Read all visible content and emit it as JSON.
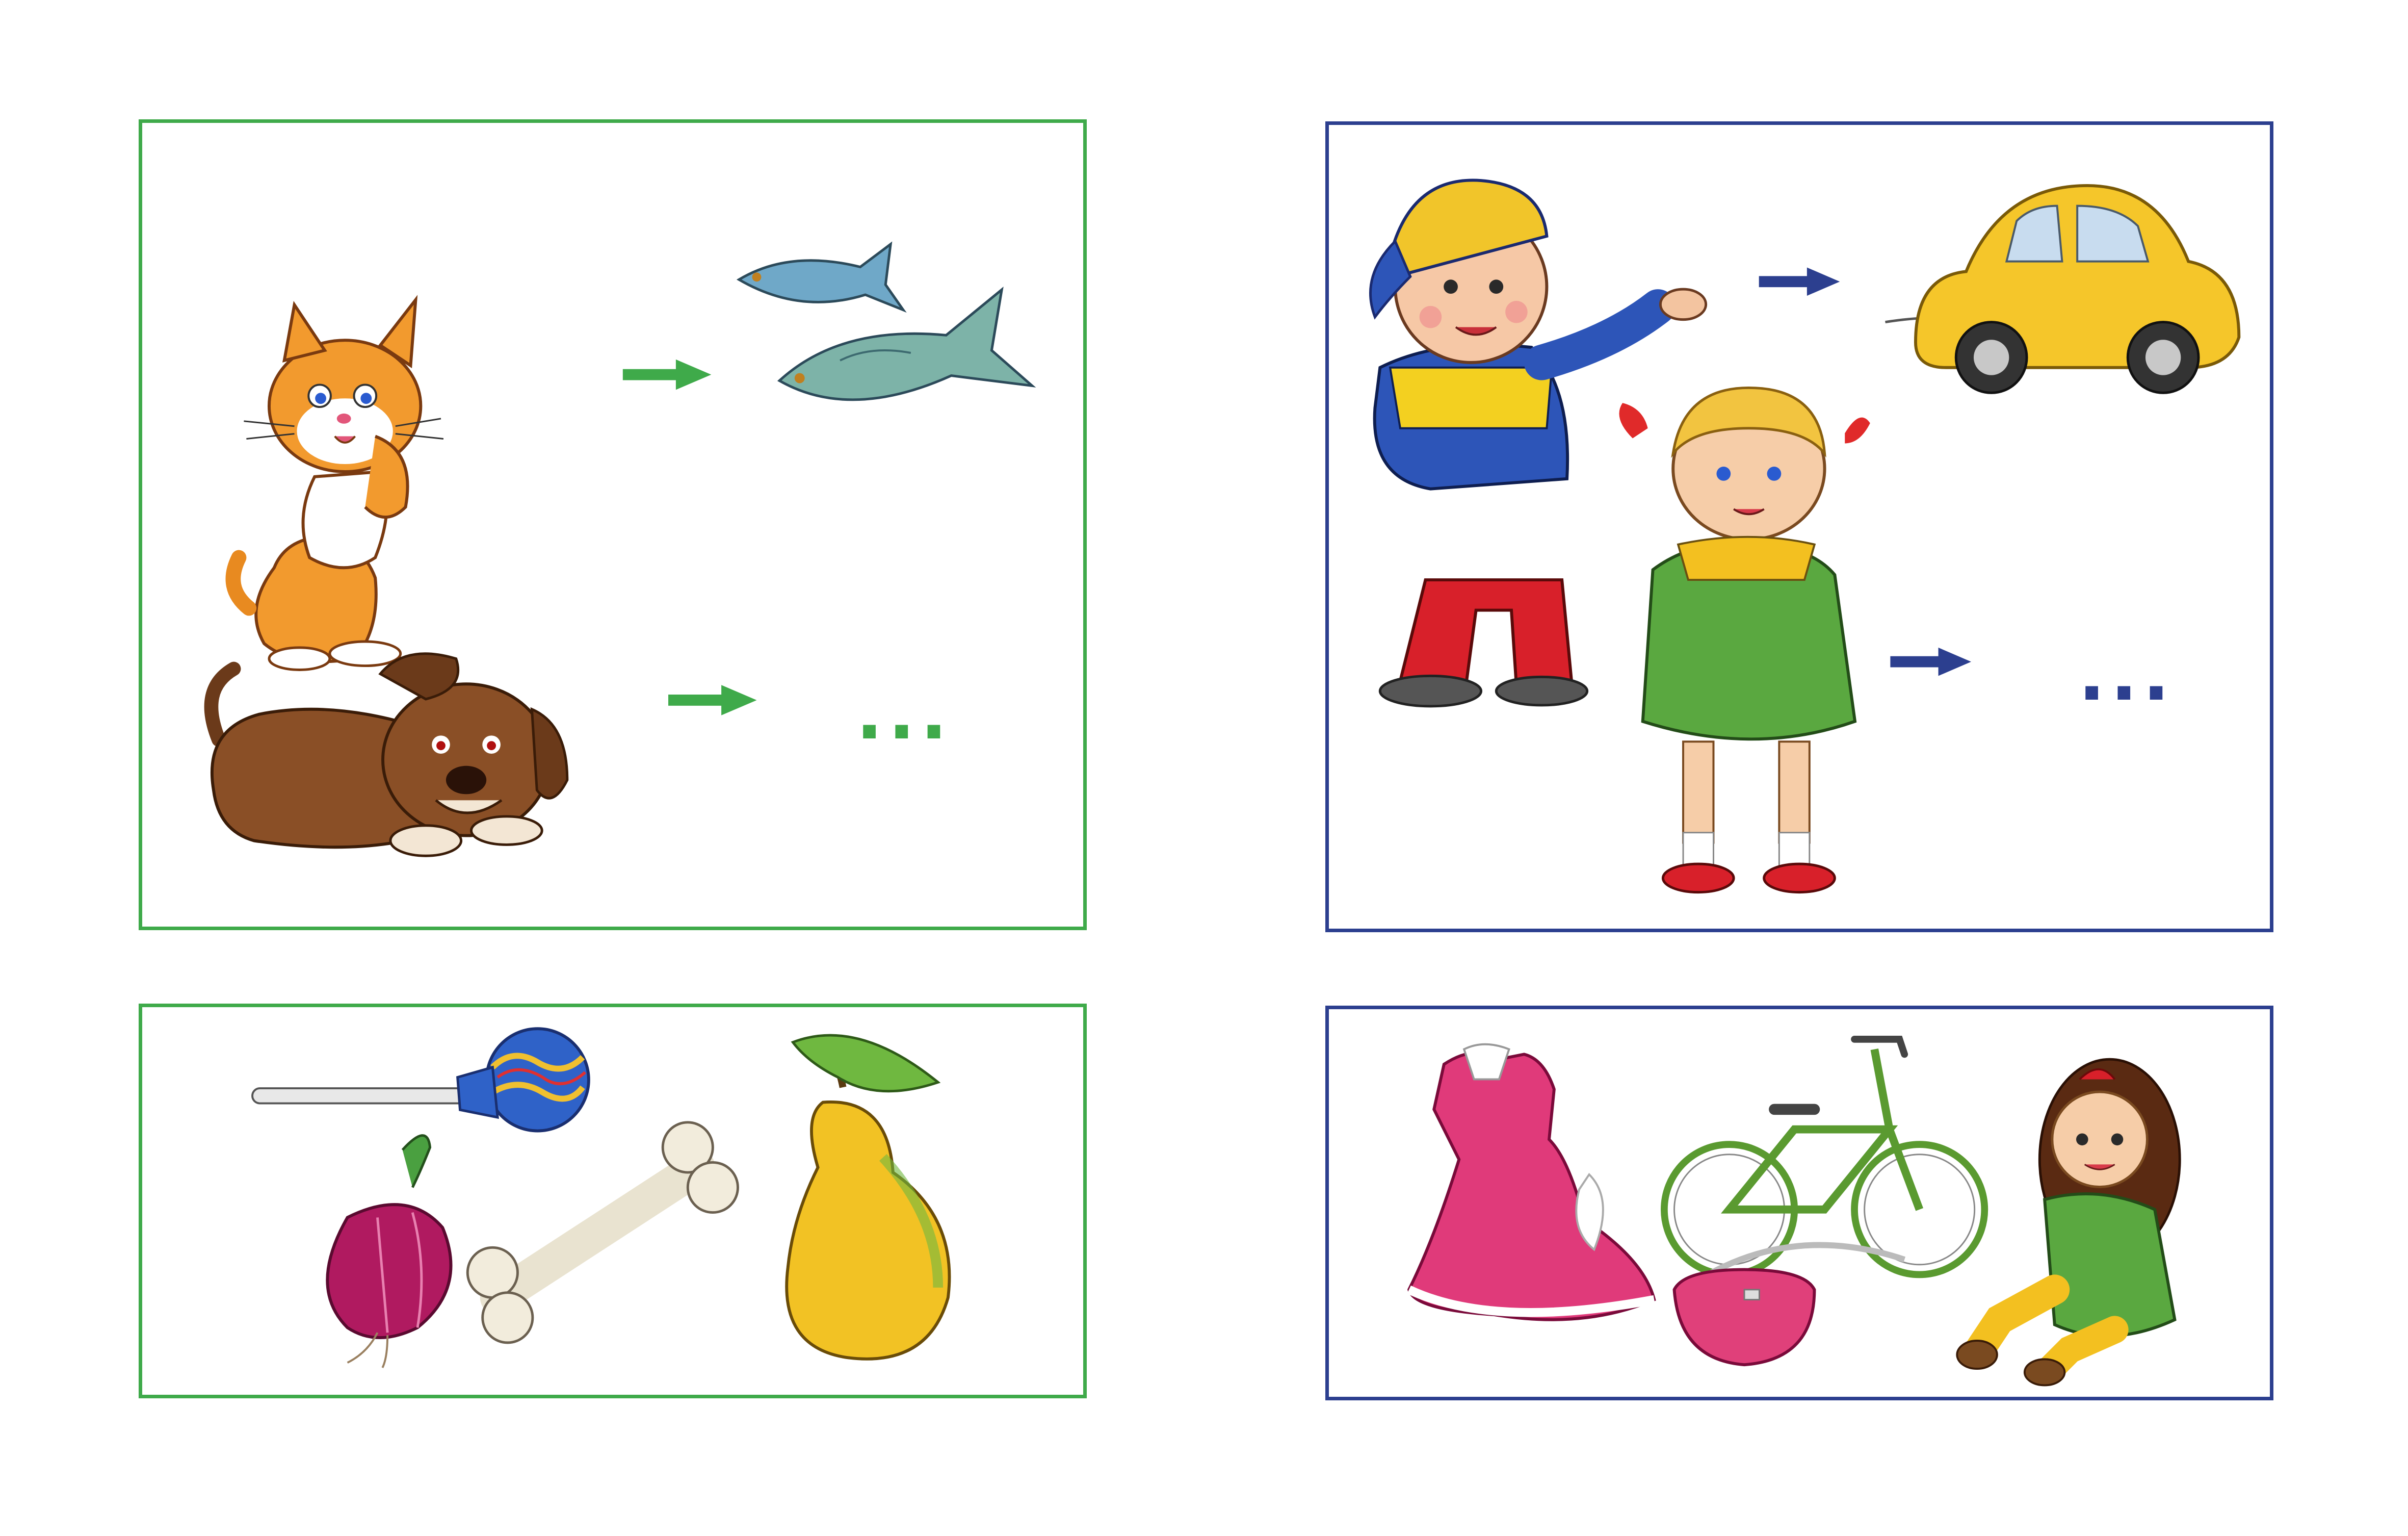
{
  "colors": {
    "green_frame": "#3faa4a",
    "blue_frame": "#2c3f8f",
    "green_arrow": "#3faa4a",
    "blue_arrow": "#2c3f8f"
  },
  "left_top": {
    "ellipsis": "...",
    "icons": [
      "cat-icon",
      "fish-icon",
      "dog-icon"
    ]
  },
  "left_bottom": {
    "icons": [
      "lollipop-icon",
      "onion-icon",
      "bone-icon",
      "pear-icon"
    ]
  },
  "right_top": {
    "ellipsis": "...",
    "icons": [
      "boy-icon",
      "toy-car-icon",
      "girl-icon"
    ]
  },
  "right_bottom": {
    "icons": [
      "dress-icon",
      "bicycle-icon",
      "handbag-icon",
      "doll-icon"
    ]
  }
}
